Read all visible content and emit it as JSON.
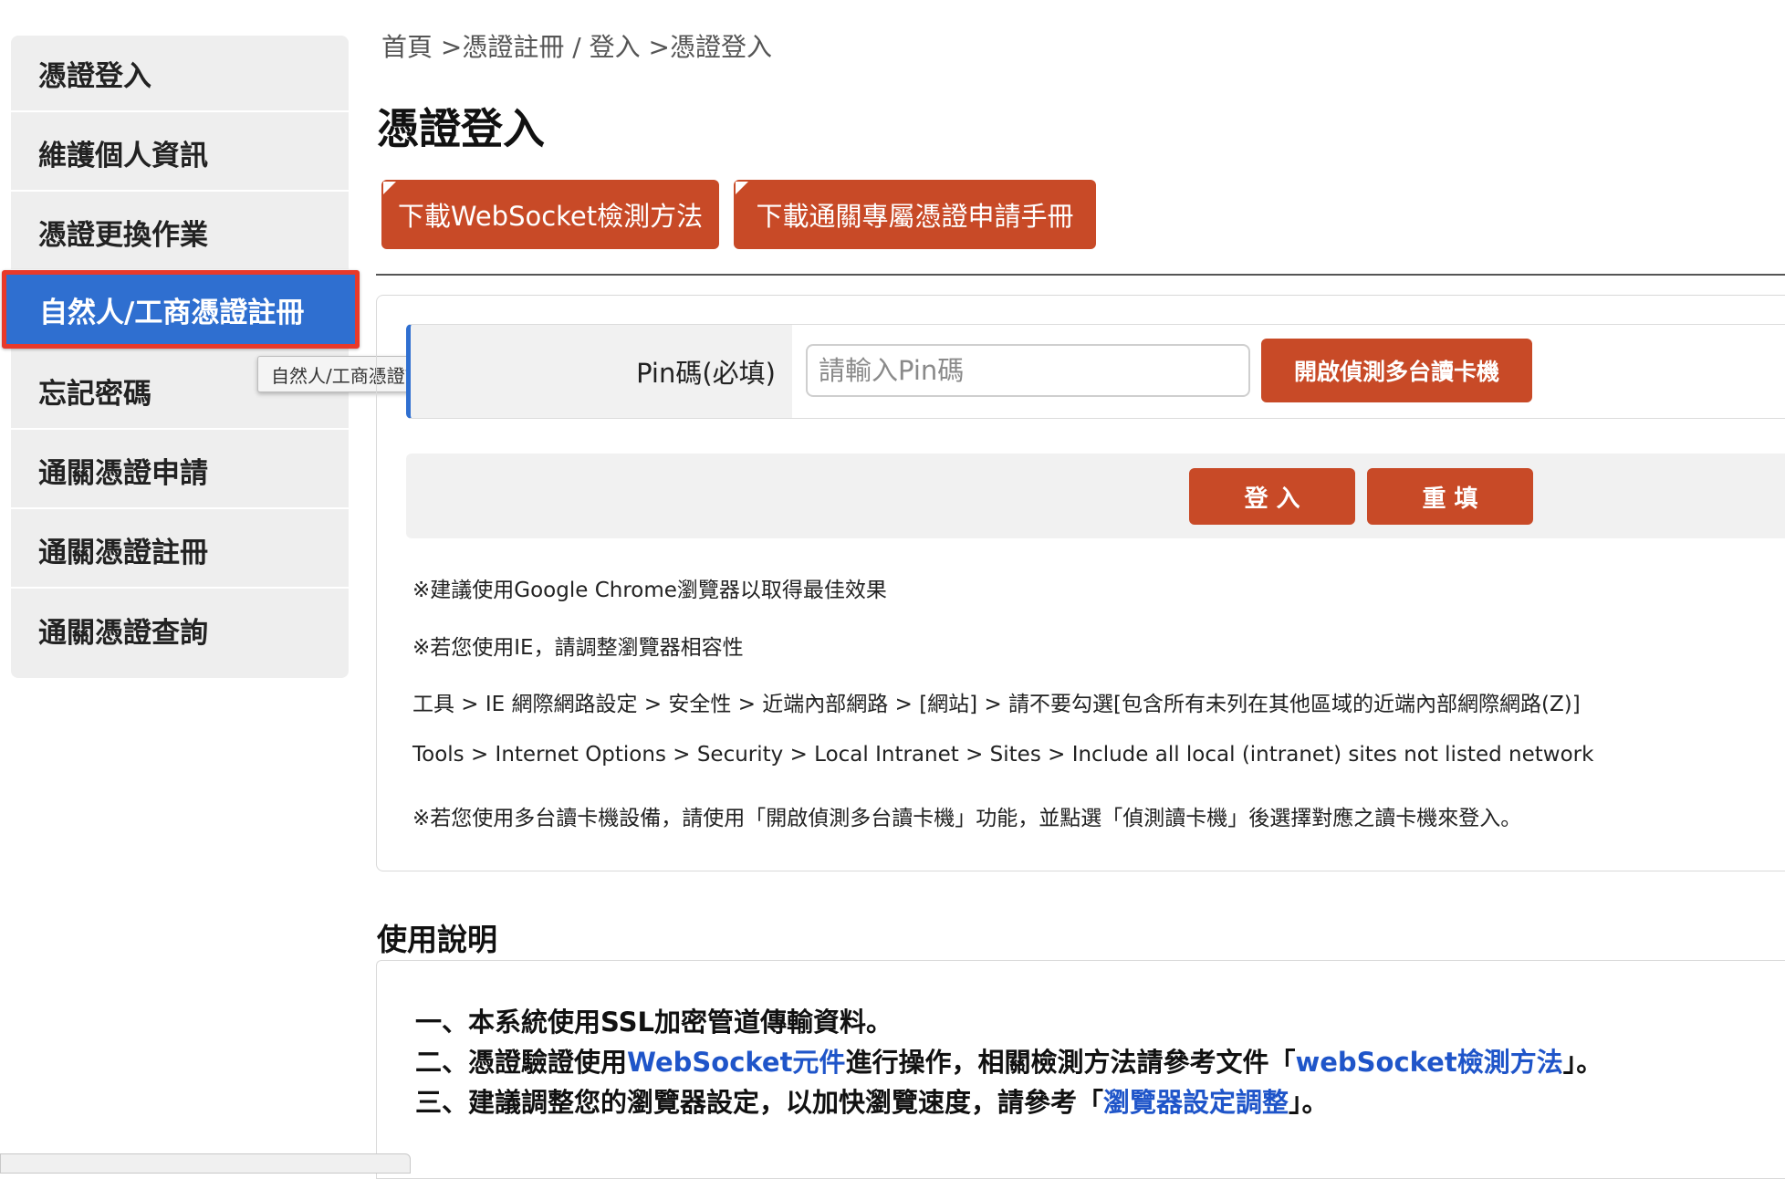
{
  "breadcrumb": "首頁 >憑證註冊 / 登入 >憑證登入",
  "page_title": "憑證登入",
  "downloads": {
    "websocket_label": "下載WebSocket檢測方法",
    "manual_label": "下載通關專屬憑證申請手冊"
  },
  "sidebar": {
    "items": [
      {
        "label": "憑證登入"
      },
      {
        "label": "維護個人資訊"
      },
      {
        "label": "憑證更換作業"
      },
      {
        "label": "自然人/工商憑證註冊"
      },
      {
        "label": "忘記密碼"
      },
      {
        "label": "通關憑證申請"
      },
      {
        "label": "通關憑證註冊"
      },
      {
        "label": "通關憑證查詢"
      }
    ],
    "active_index": 3,
    "tooltip": "自然人/工商憑證註冊"
  },
  "form": {
    "pin_label": "Pin碼(必填)",
    "pin_placeholder": "請輸入Pin碼",
    "pin_value": "",
    "detect_button": "開啟偵測多台讀卡機",
    "login_button": "登 入",
    "reset_button": "重 填"
  },
  "notes": [
    "※建議使用Google Chrome瀏覽器以取得最佳效果",
    "※若您使用IE，請調整瀏覽器相容性",
    "工具 > IE 網際網路設定 > 安全性 > 近端內部網路 > [網站] > 請不要勾選[包含所有未列在其他區域的近端內部網際網路(Z)]",
    "Tools > Internet Options > Security > Local Intranet > Sites > Include all local (intranet) sites not listed network",
    "※若您使用多台讀卡機設備，請使用「開啟偵測多台讀卡機」功能，並點選「偵測讀卡機」後選擇對應之讀卡機來登入。"
  ],
  "usage": {
    "title": "使用說明",
    "line1": "一、本系統使用SSL加密管道傳輸資料。",
    "line2_prefix": "二、憑證驗證使用",
    "line2_link1": "WebSocket元件",
    "line2_middle": "進行操作，相關檢測方法請參考文件「",
    "line2_link2": "webSocket檢測方法",
    "line2_suffix": "」。",
    "line3_prefix": "三、建議調整您的瀏覽器設定，以加快瀏覽速度，請參考「",
    "line3_link": "瀏覽器設定調整",
    "line3_suffix": "」。"
  },
  "colors": {
    "accent_blue": "#2f6fd0",
    "button_red": "#c84a27",
    "highlight_border": "#e8392a",
    "link_blue": "#1f55c9"
  }
}
